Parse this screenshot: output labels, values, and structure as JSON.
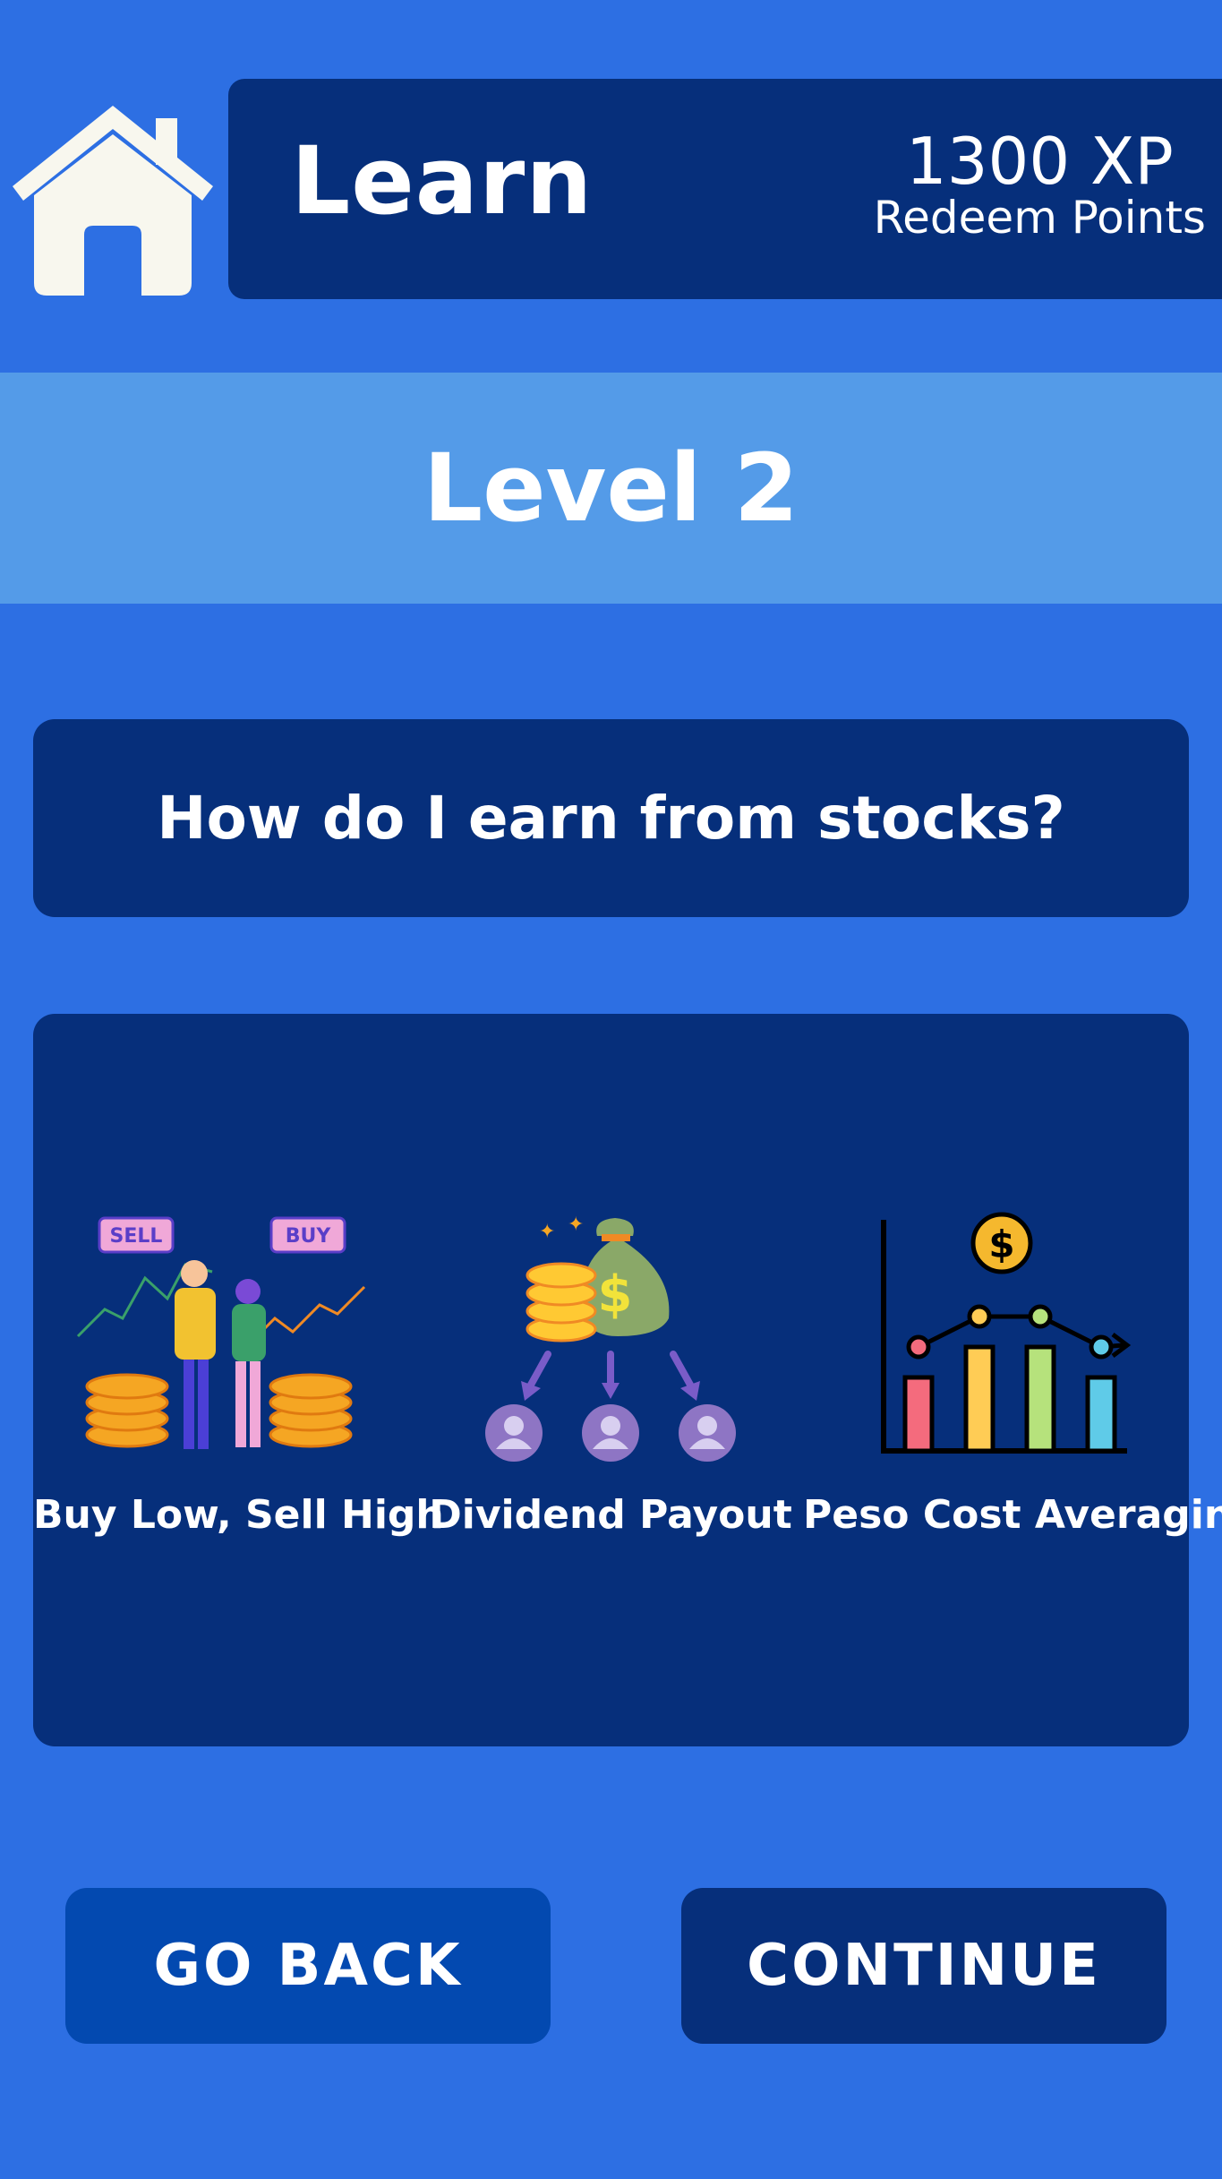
{
  "header": {
    "title": "Learn",
    "xp": "1300 XP",
    "redeem_label": "Redeem Points",
    "home_icon": "home-icon"
  },
  "level": {
    "title": "Level 2"
  },
  "question": "How do I earn from stocks?",
  "cards": [
    {
      "label": "Buy Low, Sell High",
      "icon": "buy-sell-illustration",
      "sell_tag": "SELL",
      "buy_tag": "BUY"
    },
    {
      "label": "Dividend Payout",
      "icon": "dividend-illustration",
      "currency_symbol": "$"
    },
    {
      "label": "Peso Cost Averaging",
      "icon": "bar-chart-illustration",
      "currency_symbol": "$"
    }
  ],
  "buttons": {
    "back": "GO BACK",
    "continue": "CONTINUE"
  },
  "colors": {
    "background": "#2d6fe3",
    "navy": "#062f7b",
    "band": "#549be8",
    "back_button": "#0349b0",
    "home_icon": "#f8f7ee"
  }
}
